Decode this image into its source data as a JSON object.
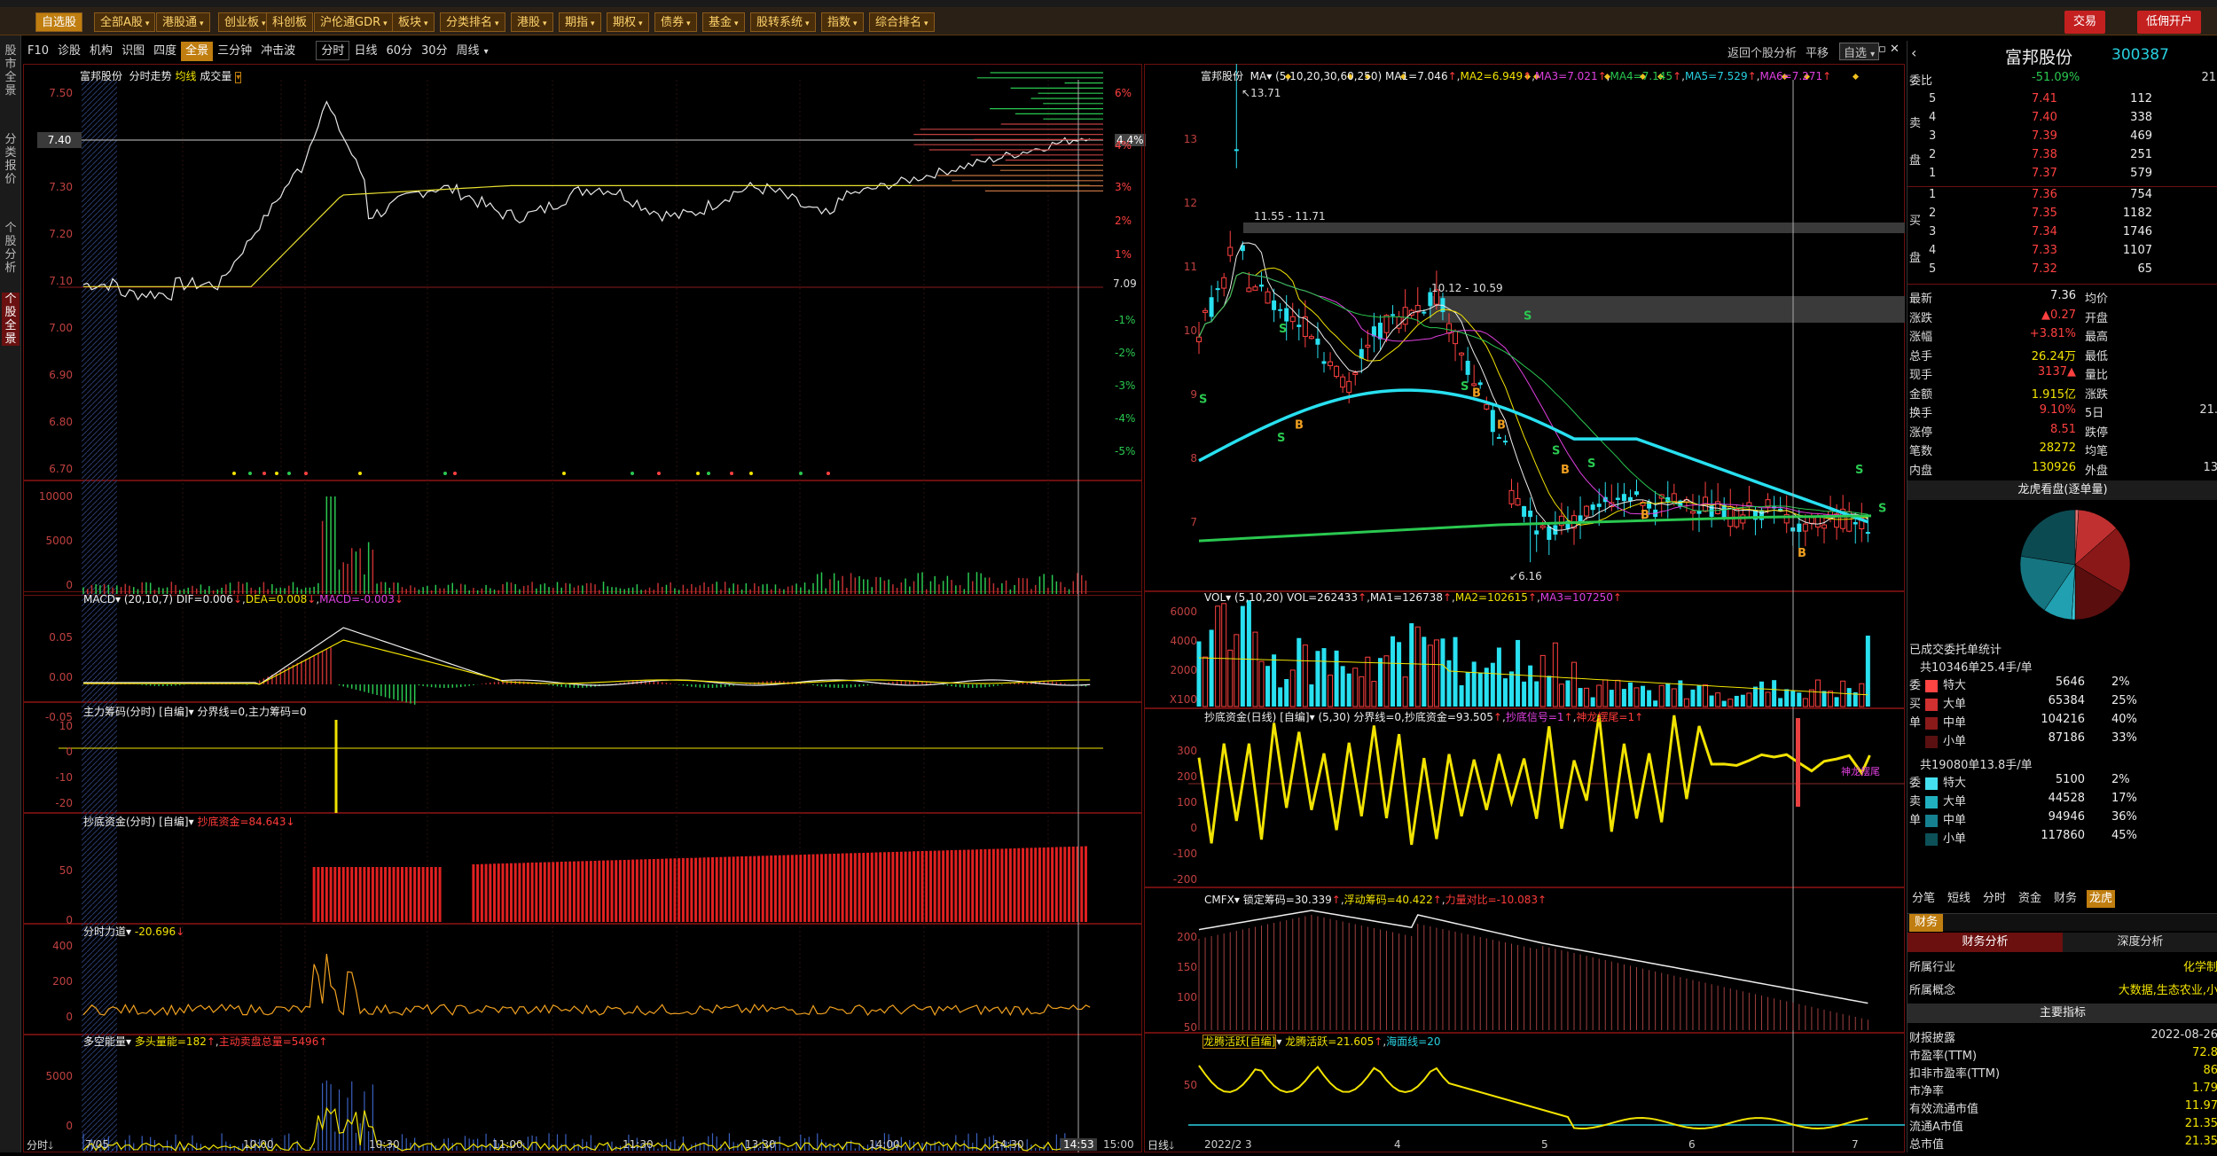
{
  "menu": {
    "items": [
      "自选股",
      "全部A股",
      "港股通",
      "创业板",
      "科创板",
      "沪伦通GDR",
      "板块",
      "分类排名",
      "港股",
      "期指",
      "期权",
      "债券",
      "基金",
      "股转系统",
      "指数",
      "综合排名"
    ],
    "right": [
      "交易",
      "低佣开户"
    ]
  },
  "sidebar": {
    "tabs": [
      "股市全景",
      "分类报价",
      "个股分析",
      "个股全景"
    ]
  },
  "tabs": {
    "left": [
      "F10",
      "诊股",
      "机构",
      "识图",
      "四度",
      "全景",
      "三分钟",
      "冲击波"
    ],
    "left_active": "全景",
    "periods": [
      "分时",
      "日线",
      "60分",
      "30分",
      "周线"
    ],
    "right_tools": [
      "返回个股分析",
      "平移",
      "自选"
    ]
  },
  "intraday": {
    "title": "富邦股份",
    "subtitle": "分时走势",
    "tag1": "均线",
    "tag2": "成交量",
    "yaxis": [
      "7.50",
      "7.40",
      "7.30",
      "7.20",
      "7.10",
      "7.00",
      "6.90",
      "6.80",
      "6.70"
    ],
    "current_price": "7.40",
    "ref_price": "7.09",
    "pct_up": [
      "6%",
      "4.4%",
      "4%",
      "3%",
      "2%",
      "1%"
    ],
    "pct_dn": [
      "-1%",
      "-2%",
      "-3%",
      "-4%",
      "-5%"
    ],
    "vol_axis": [
      "10000",
      "5000",
      "0"
    ],
    "times": [
      "7/05",
      "10:00",
      "10:30",
      "11:00",
      "11:30",
      "13:30",
      "14:00",
      "14:30",
      "14:53",
      "15:00"
    ],
    "time_label": "分时"
  },
  "macd_intraday": {
    "name": "MACD",
    "params": "(20,10,7)",
    "dif": "DIF=0.006",
    "dea": "DEA=0.008",
    "macd": "MACD=-0.003",
    "axis": [
      "0.05",
      "0.00",
      "-0.05"
    ]
  },
  "zhuli": {
    "name": "主力筹码(分时)",
    "tag": "[自编]",
    "line": "分界线=0,主力筹码=0",
    "axis": [
      "10",
      "0",
      "-10",
      "-20"
    ]
  },
  "chaodi": {
    "name": "抄底资金(分时)",
    "tag": "[自编]",
    "line": "抄底资金=84.643",
    "axis": [
      "50",
      "0"
    ]
  },
  "fenshi": {
    "name": "分时力道",
    "line": "-20.696",
    "axis": [
      "400",
      "200",
      "0"
    ]
  },
  "duokong": {
    "name": "多空能量",
    "long": "多头量能=182",
    "short": "主动卖盘总量=5496",
    "axis": [
      "5000",
      "0"
    ]
  },
  "daily": {
    "title": "富邦股份",
    "ma_label": "MA",
    "params": "(5,10,20,30,60,250)",
    "ma": [
      "MA1=7.046",
      "MA2=6.949",
      "MA3=7.021",
      "MA4=7.145",
      "MA5=7.529",
      "MA6=7.271"
    ],
    "yaxis": [
      "13",
      "12",
      "11",
      "10",
      "9",
      "8",
      "7"
    ],
    "high_label": "13.71",
    "low_label": "6.16",
    "zone1": "11.55 - 11.71",
    "zone2": "10.12 - 10.59",
    "xlabels": [
      "2022/2",
      "3",
      "4",
      "5",
      "6",
      "7"
    ],
    "period_label": "日线"
  },
  "vol_daily": {
    "name": "VOL",
    "params": "(5,10,20)",
    "vol": "VOL=262433",
    "ma1": "MA1=126738",
    "ma2": "MA2=102615",
    "ma3": "MA3=107250",
    "axis": [
      "6000",
      "4000",
      "2000",
      "0"
    ],
    "unit": "X100"
  },
  "chaodi_daily": {
    "name": "抄底资金(日线)",
    "tag": "[自编]",
    "params": "(5,30)",
    "line": "分界线=0,抄底资金=93.505",
    "sig": "抄底信号=1",
    "sig2": "神龙摆尾=1",
    "axis": [
      "300",
      "200",
      "100",
      "0",
      "-100",
      "-200"
    ],
    "tag_label": "神龙摆尾"
  },
  "cmfx": {
    "name": "CMFX",
    "a": "锁定筹码=30.339",
    "b": "浮动筹码=40.422",
    "c": "力量对比=-10.083",
    "axis": [
      "200",
      "150",
      "100",
      "50"
    ]
  },
  "longteng": {
    "name": "龙腾活跃[自编]",
    "a": "龙腾活跃=21.605",
    "b": "海面线=20",
    "axis": [
      "50"
    ]
  },
  "quote": {
    "name": "富邦股份",
    "code": "300387",
    "weibi_label": "委比",
    "weibi": "-51.09%",
    "weicha": "21",
    "sell": [
      [
        "5",
        "7.41",
        "112"
      ],
      [
        "4",
        "7.40",
        "338"
      ],
      [
        "3",
        "7.39",
        "469"
      ],
      [
        "2",
        "7.38",
        "251"
      ],
      [
        "1",
        "7.37",
        "579"
      ]
    ],
    "buy": [
      [
        "1",
        "7.36",
        "754"
      ],
      [
        "2",
        "7.35",
        "1182"
      ],
      [
        "3",
        "7.34",
        "1746"
      ],
      [
        "4",
        "7.33",
        "1107"
      ],
      [
        "5",
        "7.32",
        "65"
      ]
    ],
    "sell_label": [
      "卖",
      "盘"
    ],
    "buy_label": [
      "买",
      "盘"
    ],
    "stats": [
      [
        "最新",
        "7.36",
        "均价",
        ""
      ],
      [
        "涨跌",
        "▲0.27",
        "开盘",
        ""
      ],
      [
        "涨幅",
        "+3.81%",
        "最高",
        ""
      ],
      [
        "总手",
        "26.24万",
        "最低",
        ""
      ],
      [
        "现手",
        "3137▲",
        "量比",
        ""
      ],
      [
        "金额",
        "1.915亿",
        "涨跌",
        ""
      ],
      [
        "换手",
        "9.10%",
        "5日",
        "21."
      ],
      [
        "涨停",
        "8.51",
        "跌停",
        ""
      ],
      [
        "笔数",
        "28272",
        "均笔",
        ""
      ],
      [
        "内盘",
        "130926",
        "外盘",
        "13"
      ]
    ]
  },
  "longhu": {
    "title": "龙虎看盘(逐单量)",
    "pie": [
      {
        "v": 0.02,
        "c": "#e07070"
      },
      {
        "v": 0.25,
        "c": "#c03030"
      },
      {
        "v": 0.4,
        "c": "#8a1818"
      },
      {
        "v": 0.33,
        "c": "#5a0e0e"
      },
      {
        "v": 0.02,
        "c": "#3cc8d8"
      },
      {
        "v": 0.17,
        "c": "#20a0b0"
      },
      {
        "v": 0.36,
        "c": "#157580"
      },
      {
        "v": 0.45,
        "c": "#0c4a52"
      }
    ]
  },
  "entrust": {
    "title": "已成交委托单统计",
    "sell_total": "共10346单25.4手/单",
    "sell_side": [
      "委",
      "买",
      "单"
    ],
    "sell_rows": [
      [
        "特大",
        "5646",
        "2%",
        "#ff4444"
      ],
      [
        "大单",
        "65384",
        "25%",
        "#d03030"
      ],
      [
        "中单",
        "104216",
        "40%",
        "#8a1a1a"
      ],
      [
        "小单",
        "87186",
        "33%",
        "#5a1010"
      ]
    ],
    "buy_total": "共19080单13.8手/单",
    "buy_side": [
      "委",
      "卖",
      "单"
    ],
    "buy_rows": [
      [
        "特大",
        "5100",
        "2%",
        "#44e0f0"
      ],
      [
        "大单",
        "44528",
        "17%",
        "#20b0c0"
      ],
      [
        "中单",
        "94946",
        "36%",
        "#158090"
      ],
      [
        "小单",
        "117860",
        "45%",
        "#0c5058"
      ]
    ]
  },
  "bottom_tabs": [
    "分笔",
    "短线",
    "分时",
    "资金",
    "财务",
    "龙虎"
  ],
  "bottom_active": "龙虎",
  "finance": {
    "tab": "财务",
    "sub_tabs": [
      "财务分析",
      "深度分析"
    ],
    "industry_label": "所属行业",
    "industry": "化学制",
    "concept_label": "所属概念",
    "concept": "大数据,生态农业,小",
    "main_label": "主要指标",
    "rows": [
      [
        "财报披露",
        "2022-08-26"
      ],
      [
        "市盈率(TTM)",
        "72.8"
      ],
      [
        "扣非市盈率(TTM)",
        "86"
      ],
      [
        "市净率",
        "1.79"
      ],
      [
        "有效流通市值",
        "11.97"
      ],
      [
        "流通A市值",
        "21.35"
      ],
      [
        "总市值",
        "21.35"
      ]
    ]
  }
}
